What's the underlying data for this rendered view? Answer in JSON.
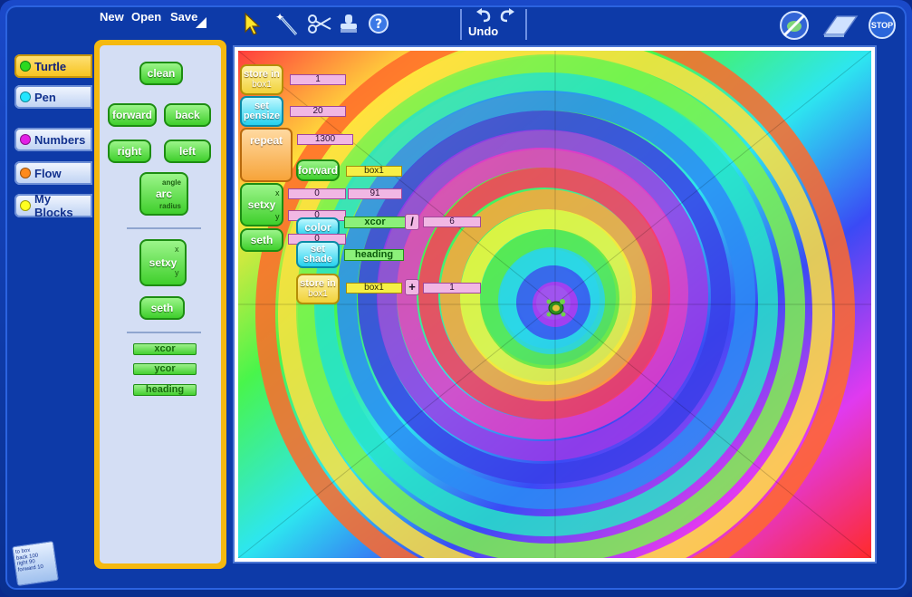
{
  "menu": {
    "new": "New",
    "open": "Open",
    "save": "Save"
  },
  "toolbar": {
    "tools": [
      "arrow-icon",
      "magic-wand-icon",
      "scissors-icon",
      "stamp-icon",
      "help-icon"
    ],
    "undo_label": "Undo",
    "right_tools": [
      "no-turtle-icon",
      "eraser-icon",
      "stop-icon"
    ],
    "stop_text": "STOP"
  },
  "tabs": [
    {
      "label": "Turtle",
      "color": "#2bd91f",
      "active": true
    },
    {
      "label": "Pen",
      "color": "#22e5ff"
    },
    {
      "label": "Numbers",
      "color": "#e21fe6"
    },
    {
      "label": "Flow",
      "color": "#ff8a1c"
    },
    {
      "label": "My Blocks",
      "color": "#ffff1f"
    }
  ],
  "palette": {
    "clean": "clean",
    "forward": "forward",
    "back": "back",
    "right": "right",
    "left": "left",
    "arc": "arc",
    "arc_angle": "angle",
    "arc_radius": "radius",
    "setxy": "setxy",
    "setxy_x": "x",
    "setxy_y": "y",
    "seth": "seth",
    "xcor": "xcor",
    "ycor": "ycor",
    "heading": "heading"
  },
  "program": {
    "store_in_1": {
      "line1": "store in",
      "line2": "box1",
      "value": "1"
    },
    "set_pensize": {
      "line1": "set",
      "line2": "pensize",
      "value": "20"
    },
    "repeat": {
      "label": "repeat",
      "value": "1300"
    },
    "forward": {
      "label": "forward",
      "arg": "box1"
    },
    "setxy": {
      "label": "setxy",
      "x_label": "x",
      "y_label": "y",
      "x": "0",
      "y": "91"
    },
    "color": {
      "label": "color",
      "value": "0",
      "xcor": "xcor",
      "div": "/",
      "divisor": "6"
    },
    "seth": {
      "label": "seth",
      "value": "0"
    },
    "set_shade": {
      "line1": "set",
      "line2": "shade",
      "arg": "heading"
    },
    "store_in_2": {
      "line1": "store in",
      "line2": "box1",
      "arg": "box1",
      "plus": "+",
      "addend": "1"
    }
  },
  "notes_icon": [
    "to box",
    "back 100",
    "right 90",
    "forward 10"
  ]
}
